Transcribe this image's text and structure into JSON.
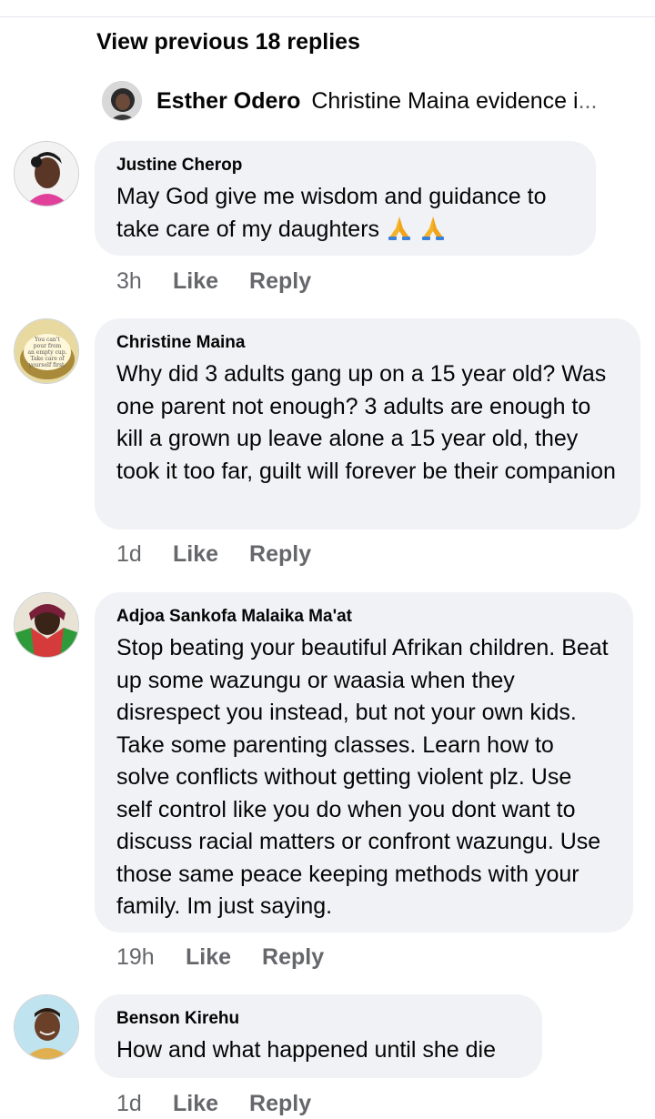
{
  "view_previous": "View previous 18 replies",
  "reply_preview": {
    "name": "Esther Odero",
    "text": "Christine Maina evidence i",
    "ellipsis": "..."
  },
  "comments": [
    {
      "author": "Justine Cherop",
      "text": "May God give me wisdom and guidance to take care of my daughters",
      "emoji": "🙏🙏",
      "time": "3h",
      "like": "Like",
      "reply": "Reply"
    },
    {
      "author": "Christine Maina",
      "text": "Why did 3 adults gang up on a 15 year old? Was one parent not enough? 3 adults are enough to kill a grown up leave alone a 15 year old, they took it too far, guilt will forever be their companion",
      "avatar_text": "You can't pour from an empty cup. Take care of yourself first.",
      "time": "1d",
      "like": "Like",
      "reply": "Reply"
    },
    {
      "author": "Adjoa Sankofa Malaika Ma'at",
      "text": "Stop beating your beautiful Afrikan children. Beat up some wazungu or waasia when they disrespect you instead, but not your own kids. Take some parenting classes. Learn how to solve conflicts without getting violent plz. Use self control like you do when you dont want to discuss racial matters or confront wazungu. Use those same peace keeping methods with your family. Im just saying.",
      "time": "19h",
      "like": "Like",
      "reply": "Reply"
    },
    {
      "author": "Benson Kirehu",
      "text": "How and what happened until she die",
      "time": "1d",
      "like": "Like",
      "reply": "Reply"
    }
  ],
  "colors": {
    "bubble": "#f0f2f5",
    "secondary_text": "#65676b",
    "primary_text": "#050505"
  }
}
